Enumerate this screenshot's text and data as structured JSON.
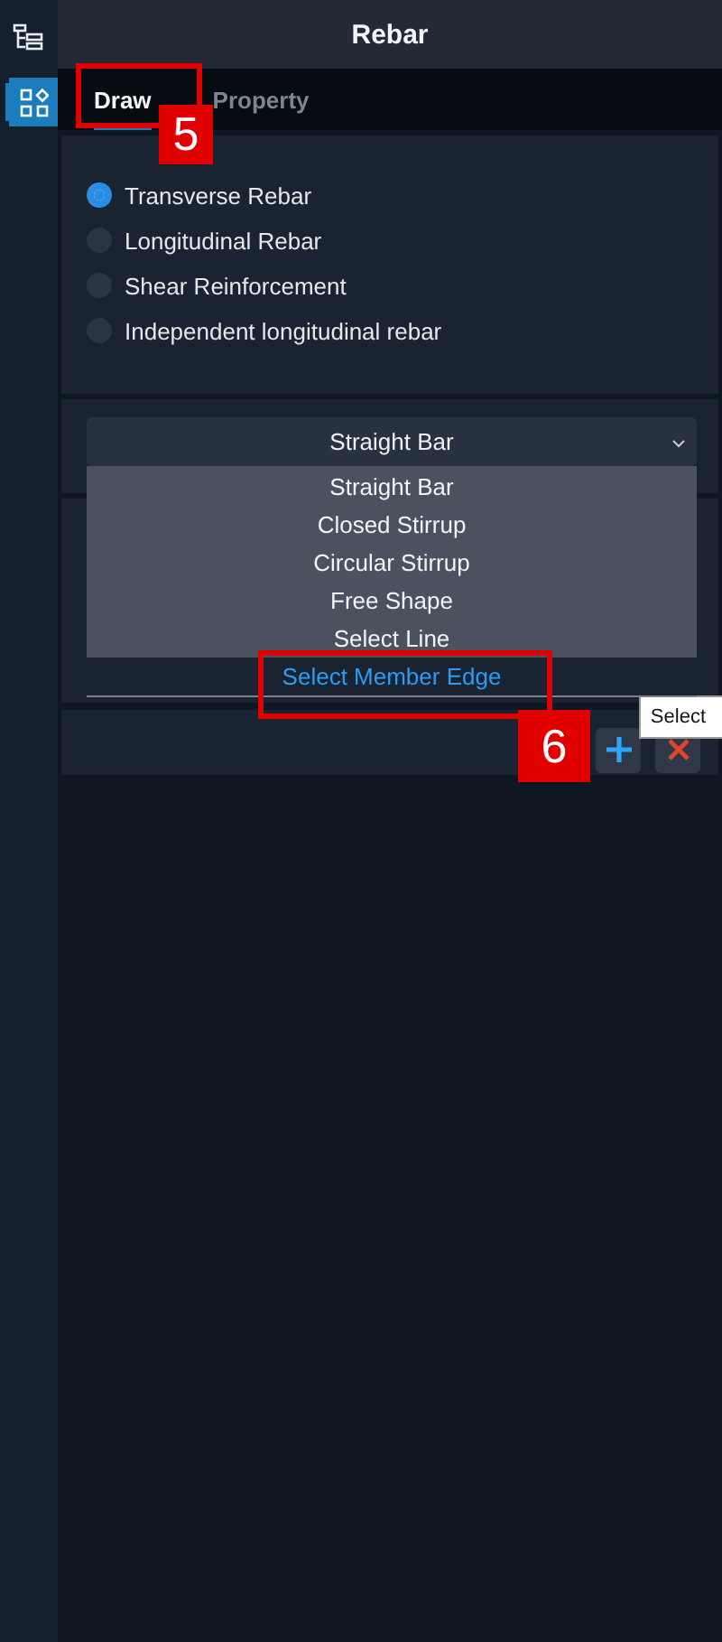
{
  "panel": {
    "title": "Rebar"
  },
  "tabs": [
    {
      "label": "Draw",
      "selected": true
    },
    {
      "label": "Property",
      "selected": false
    }
  ],
  "rebar_types": [
    {
      "label": "Transverse Rebar",
      "selected": true
    },
    {
      "label": "Longitudinal Rebar",
      "selected": false
    },
    {
      "label": "Shear Reinforcement",
      "selected": false
    },
    {
      "label": "Independent longitudinal rebar",
      "selected": false
    }
  ],
  "shape_dropdown": {
    "value": "Straight Bar",
    "expanded": true,
    "options": [
      {
        "label": "Straight Bar",
        "highlighted": false
      },
      {
        "label": "Closed Stirrup",
        "highlighted": false
      },
      {
        "label": "Circular Stirrup",
        "highlighted": false
      },
      {
        "label": "Free Shape",
        "highlighted": false
      },
      {
        "label": "Select Line",
        "highlighted": false
      },
      {
        "label": "Select Member Edge",
        "highlighted": true
      }
    ]
  },
  "tooltip": "Select",
  "callouts": [
    "5",
    "6"
  ]
}
